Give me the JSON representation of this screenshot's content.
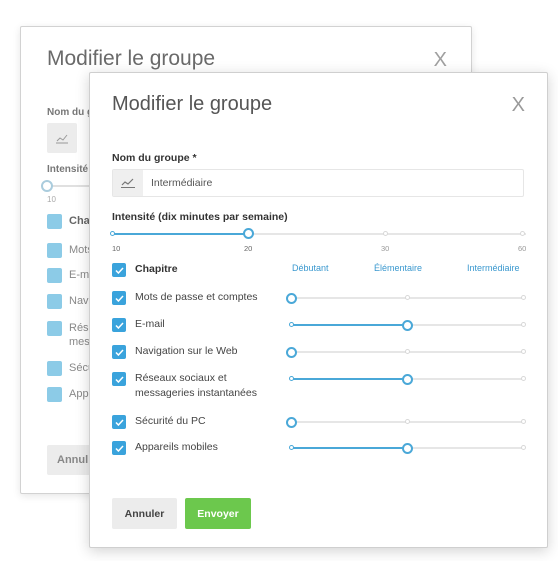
{
  "back_dialog": {
    "title": "Modifier le groupe",
    "close": "X",
    "name_label": "Nom du g",
    "intensity_label": "Intensité",
    "tick_10": "10",
    "rows": [
      "Chap",
      "Mots",
      "E-m",
      "Navi",
      "Rése",
      "mes",
      "Sécu",
      "Appa"
    ],
    "cancel_label": "Annul"
  },
  "dialog": {
    "title": "Modifier le groupe",
    "close": "X",
    "group_name_label": "Nom du groupe *",
    "group_name_value": "Intermédiaire",
    "intensity_label": "Intensité (dix minutes par semaine)",
    "intensity": {
      "ticks": [
        "10",
        "20",
        "30",
        "60"
      ],
      "value": "20"
    },
    "chapter_header": "Chapitre",
    "levels": [
      "Débutant",
      "Élémentaire",
      "Intermédiaire"
    ],
    "chapters": [
      {
        "line1": "Mots de passe et comptes",
        "line2": "",
        "level": "Débutant",
        "level_index": 0
      },
      {
        "line1": "E-mail",
        "line2": "",
        "level": "Élémentaire",
        "level_index": 1
      },
      {
        "line1": "Navigation sur le Web",
        "line2": "",
        "level": "Débutant",
        "level_index": 0
      },
      {
        "line1": "Réseaux sociaux et",
        "line2": "messageries instantanées",
        "level": "Élémentaire",
        "level_index": 1
      },
      {
        "line1": "Sécurité du PC",
        "line2": "",
        "level": "Débutant",
        "level_index": 0
      },
      {
        "line1": "Appareils mobiles",
        "line2": "",
        "level": "Élémentaire",
        "level_index": 1
      }
    ],
    "cancel_label": "Annuler",
    "submit_label": "Envoyer"
  },
  "colors": {
    "accent": "#4aa8d8",
    "checkbox": "#3aa3dc",
    "submit": "#6cc84d",
    "level_text": "#3a98cf"
  },
  "icons": {
    "name_field": "chart-line-icon",
    "checkbox": "check-icon"
  }
}
